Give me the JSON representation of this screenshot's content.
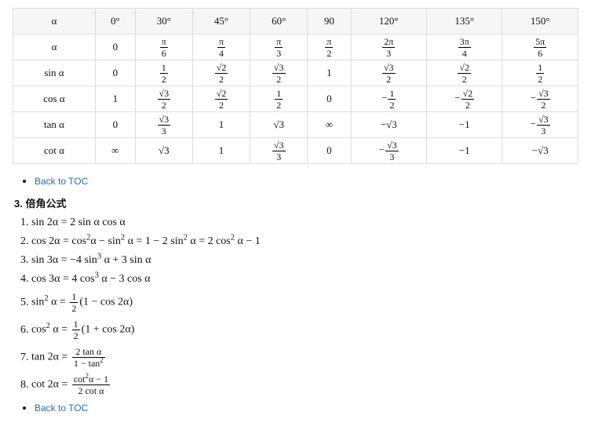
{
  "table": {
    "cols": [
      "α",
      "0°",
      "30°",
      "45°",
      "60°",
      "90",
      "120°",
      "135°",
      "150°"
    ],
    "rows": [
      {
        "label": "α",
        "cells": [
          "0",
          "π/6",
          "π/4",
          "π/3",
          "π/2",
          "2π/3",
          "3π/4",
          "5π/6"
        ]
      },
      {
        "label": "sin α",
        "cells": [
          "0",
          "1/2",
          "√2/2",
          "√3/2",
          "1",
          "√3/2",
          "√2/2",
          "1/2"
        ]
      },
      {
        "label": "cos α",
        "cells": [
          "1",
          "√3/2",
          "√2/2",
          "1/2",
          "0",
          "-1/2",
          "-√2/2",
          "-√3/2"
        ]
      },
      {
        "label": "tan α",
        "cells": [
          "0",
          "√3/3",
          "1",
          "√3",
          "∞",
          "-√3",
          "-1",
          "-√3/3"
        ]
      },
      {
        "label": "cot α",
        "cells": [
          "∞",
          "√3",
          "1",
          "√3/3",
          "0",
          "-√3/3",
          "-1",
          "-√3"
        ]
      }
    ]
  },
  "toc_link": "Back to TOC",
  "section_number": "3.",
  "section_title": "倍角公式",
  "formulas": [
    "sin 2α = 2 sin α cos α",
    "cos 2α = cos²α − sin² α = 1 − 2 sin² α = 2 cos² α − 1",
    "sin 3α = −4 sin³ α + 3 sin α",
    "cos 3α = 4 cos³ α − 3 cos α",
    "sin² α = ½(1 − cos 2α)",
    "cos² α = ½(1 + cos 2α)",
    "tan 2α = 2 tan α / (1 − tan²)",
    "cot 2α = (cot²α − 1) / (2 cot α)"
  ]
}
